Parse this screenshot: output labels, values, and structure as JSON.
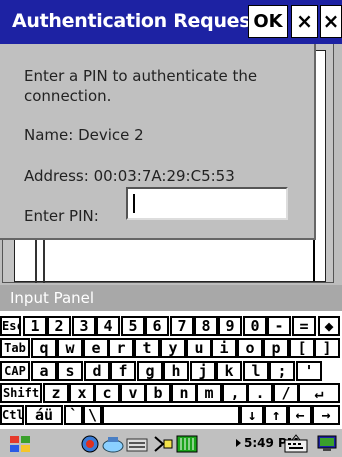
{
  "dialog": {
    "title": "Authentication Request",
    "ok_label": "OK",
    "close_label": "×",
    "close2_label": "×",
    "prompt": "Enter a PIN to authenticate the connection.",
    "name_label": "Name:",
    "name_value": "Device 2",
    "address_label": "Address:",
    "address_value": "00:03:7A:29:C5:53",
    "pin_label": "Enter PIN:",
    "pin_value": ""
  },
  "input_panel": {
    "title": "Input Panel",
    "rows": [
      [
        "Esc",
        "1",
        "2",
        "3",
        "4",
        "5",
        "6",
        "7",
        "8",
        "9",
        "0",
        "-",
        "=",
        "◆"
      ],
      [
        "Tab",
        "q",
        "w",
        "e",
        "r",
        "t",
        "y",
        "u",
        "i",
        "o",
        "p",
        "[",
        "]"
      ],
      [
        "CAP",
        "a",
        "s",
        "d",
        "f",
        "g",
        "h",
        "j",
        "k",
        "l",
        ";",
        "'"
      ],
      [
        "Shift",
        "z",
        "x",
        "c",
        "v",
        "b",
        "n",
        "m",
        ",",
        ".",
        "/",
        "↵"
      ],
      [
        "Ctl",
        "áü",
        "`",
        "\\",
        "",
        "↓",
        "↑",
        "←",
        "→"
      ]
    ]
  },
  "taskbar": {
    "clock": "5:49 PM"
  },
  "colors": {
    "title_bar": "#1d22a3",
    "dialog_bg": "#c0c0c0",
    "panel_header": "#a8a8a8"
  }
}
